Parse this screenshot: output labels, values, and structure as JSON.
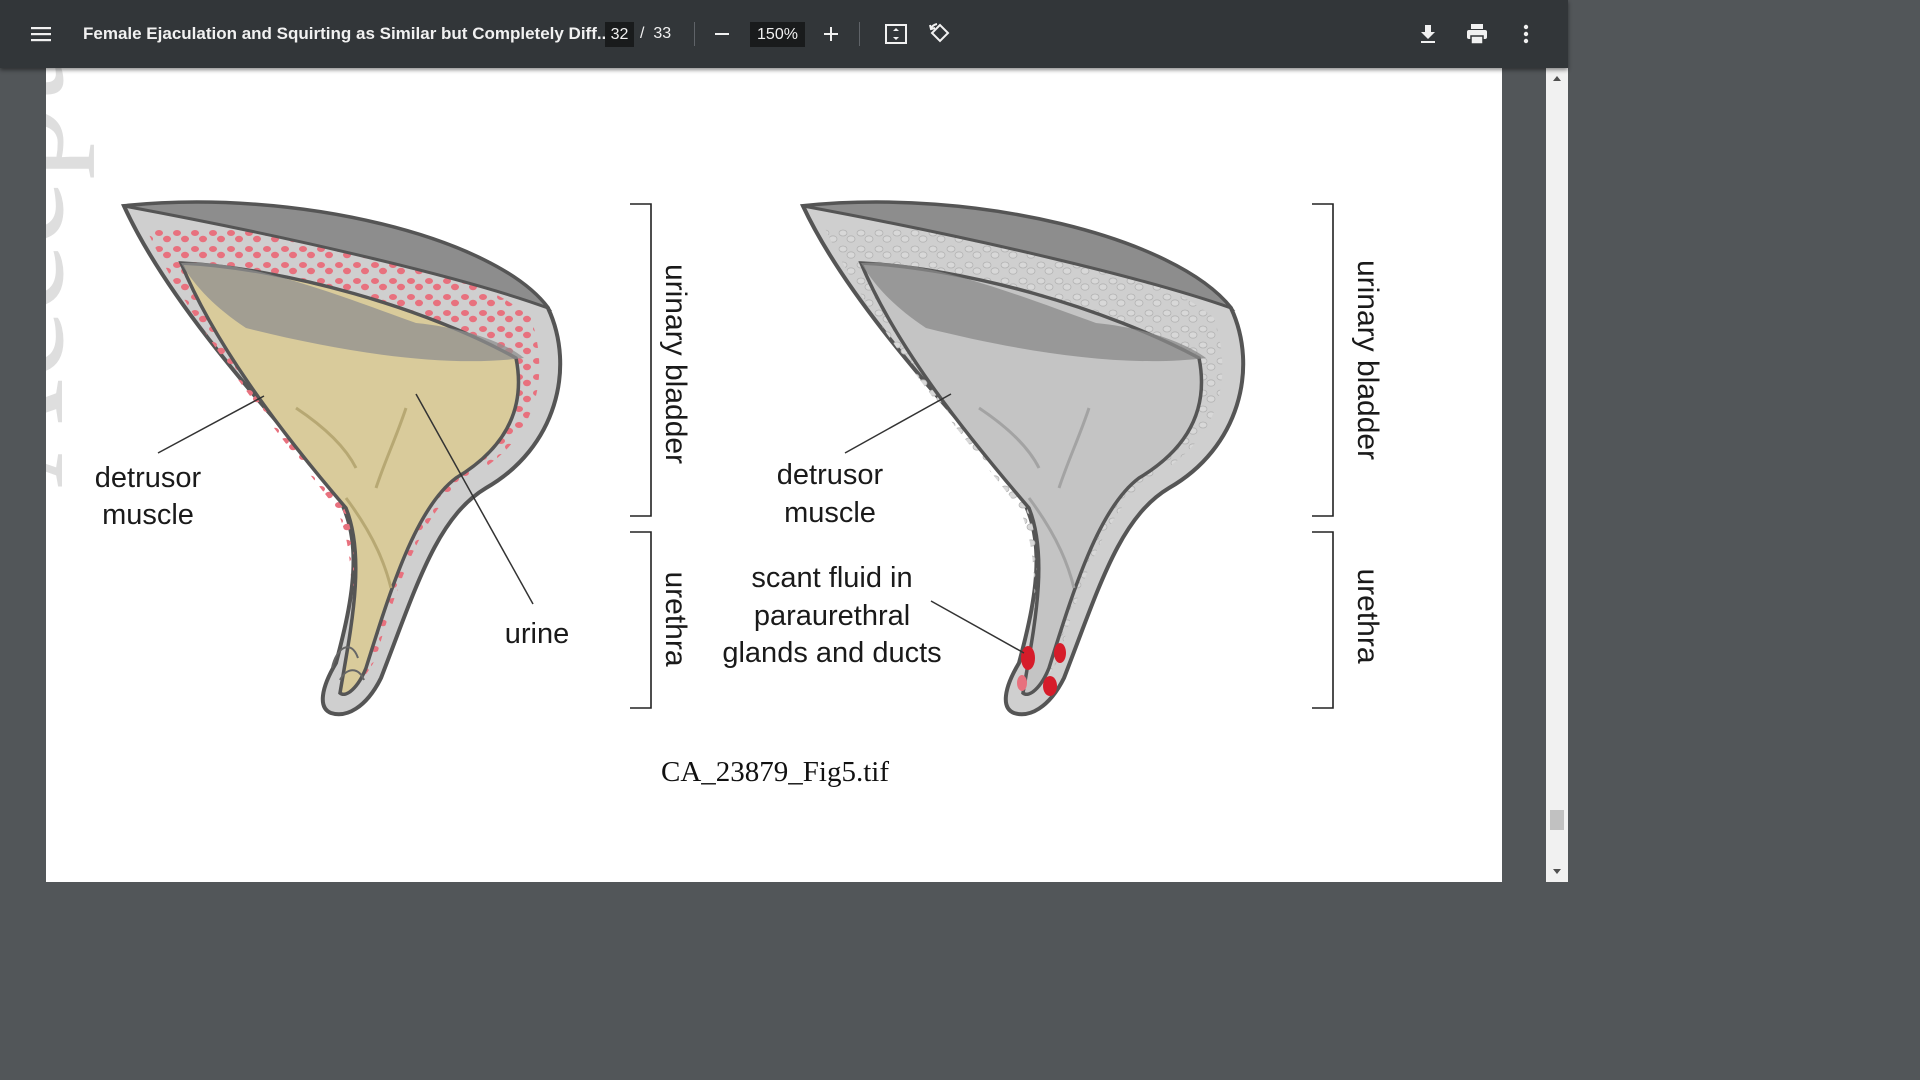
{
  "toolbar": {
    "title": "Female Ejaculation and Squirting as Similar but Completely Diff...",
    "current_page": "32",
    "page_separator": "/",
    "total_pages": "33",
    "zoom": "150%",
    "icons": [
      "menu-icon",
      "zoom-out-icon",
      "zoom-in-icon",
      "fit-page-icon",
      "rotate-icon",
      "download-icon",
      "print-icon",
      "more-icon"
    ]
  },
  "document": {
    "watermark": "Accepted Arti",
    "caption": "CA_23879_Fig5.tif",
    "figure": {
      "left_panel": {
        "label_detrusor_1": "detrusor",
        "label_detrusor_2": "muscle",
        "label_urine": "urine",
        "bracket_bladder": "urinary bladder",
        "bracket_urethra": "urethra"
      },
      "right_panel": {
        "label_detrusor_1": "detrusor",
        "label_detrusor_2": "muscle",
        "label_fluid_1": "scant fluid in",
        "label_fluid_2": "paraurethral",
        "label_fluid_3": "glands and ducts",
        "bracket_bladder": "urinary bladder",
        "bracket_urethra": "urethra"
      }
    },
    "colors": {
      "urine": "#d9cb9b",
      "muscle_fiber": "#e8717e",
      "gland": "#d61c2a",
      "tissue": "#c9c9c9"
    }
  }
}
